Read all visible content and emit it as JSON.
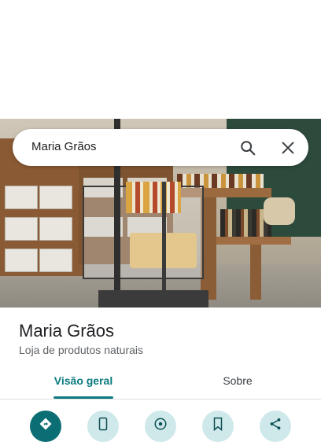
{
  "search": {
    "query": "Maria Grãos"
  },
  "place": {
    "name": "Maria Grãos",
    "category": "Loja de produtos naturais"
  },
  "tabs": [
    {
      "label": "Visão geral",
      "selected": true
    },
    {
      "label": "Sobre",
      "selected": false
    }
  ],
  "actions": [
    {
      "icon": "directions-icon"
    },
    {
      "icon": "phone-icon"
    },
    {
      "icon": "website-icon"
    },
    {
      "icon": "save-icon"
    },
    {
      "icon": "share-icon"
    }
  ],
  "colors": {
    "accent": "#0b7a80",
    "action_primary": "#0b6e74",
    "action_secondary": "#cfe8ea"
  }
}
